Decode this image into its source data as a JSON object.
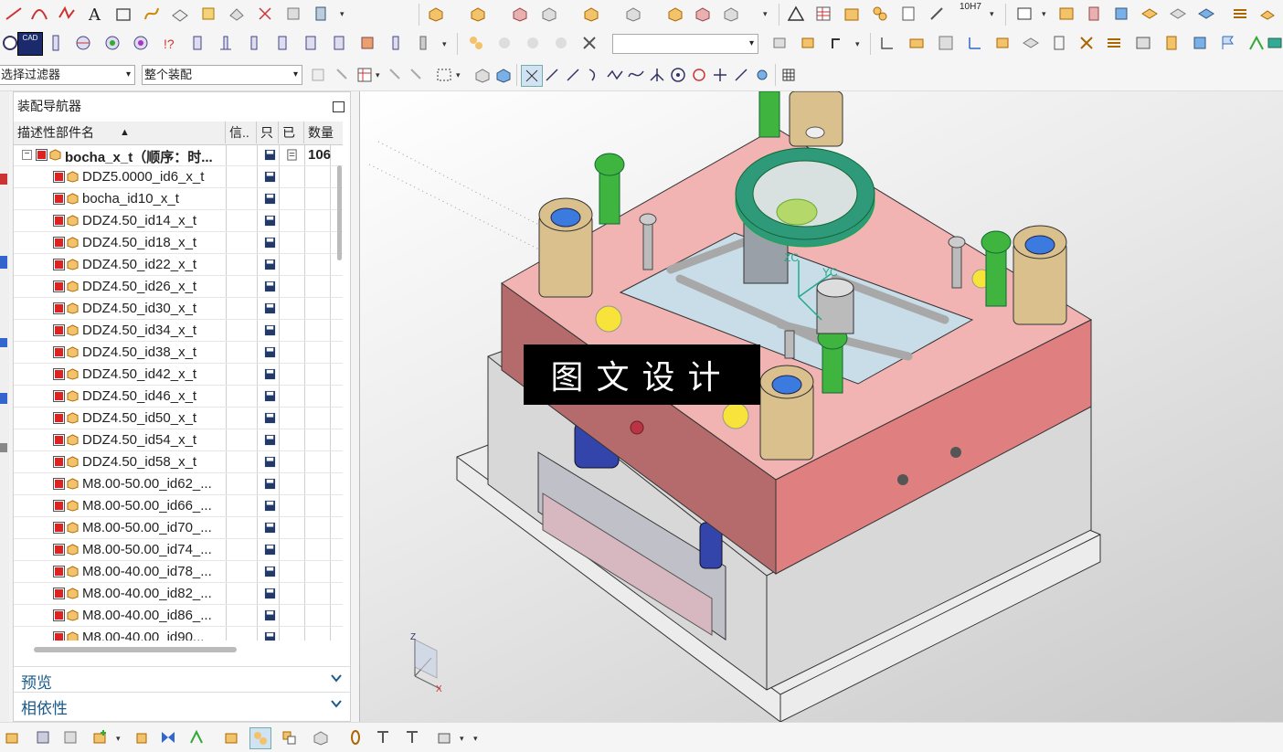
{
  "toolbar": {
    "row1_icons": [
      "line-icon",
      "arc-icon",
      "spline-icon",
      "text-icon",
      "sketch-icon",
      "curve-icon",
      "surface-icon",
      "extract-icon",
      "offset-icon",
      "project-icon",
      "intersect-icon",
      "section-icon",
      "boolean-icon",
      "extrude-icon",
      "revolve-icon",
      "hole-icon",
      "boss-icon",
      "pocket-icon",
      "pad-icon",
      "chamfer-icon",
      "shell-icon",
      "triangle-icon",
      "table-icon",
      "analysis-icon",
      "measure-icon",
      "document-icon",
      "drafting-icon",
      "tolerance-icon",
      "frame-icon",
      "mold-icon",
      "door-icon",
      "block-icon",
      "slab-icon",
      "layer-icon",
      "book-icon",
      "stack-icon",
      "chair-icon"
    ],
    "tolerance_label": "10H7",
    "row2_icons": [
      "view-icon",
      "cad-icon",
      "pin-icon",
      "cross-icon",
      "target-icon",
      "circle-target-icon",
      "exclaim-icon",
      "bracket-icon",
      "pillar-icon",
      "column-icon",
      "rail-icon",
      "slot-icon",
      "frame-icon",
      "grid-icon",
      "bar-icon",
      "divider-icon"
    ],
    "row2_right_icons": [
      "assembly-icon",
      "component-icon",
      "pattern-icon",
      "mirror-icon",
      "tools-icon",
      "cube-icon",
      "cube-yellow-icon",
      "music-note-icon",
      "hierarchy-icon",
      "plate-icon",
      "matrix-icon",
      "coordinate-icon",
      "box-icon",
      "section-view-icon",
      "bracket-view-icon",
      "wrench-icon",
      "stack-icon",
      "ladder-icon",
      "bars-icon",
      "profile-icon",
      "flag-icon",
      "crane-icon",
      "layer-icon"
    ],
    "cad_label": "CAD",
    "filter_select": "选择过滤器",
    "scope_select": "整个装配",
    "row3_icons": [
      "snap-icon",
      "select-icon",
      "move-icon",
      "copy-icon",
      "rect-select-icon",
      "solid-icon",
      "cube-blue-icon",
      "point-snap-icon",
      "line-snap-icon",
      "line2-snap-icon",
      "curve-snap-icon",
      "spline-snap-icon",
      "wave-snap-icon",
      "intersection-snap-icon",
      "center-snap-icon",
      "quadrant-snap-icon",
      "plus-snap-icon",
      "tangent-snap-icon",
      "existing-point-icon",
      "grid-icon"
    ]
  },
  "navigator": {
    "title": "装配导航器",
    "columns": {
      "name": "描述性部件名",
      "info": "信..",
      "c1": "只",
      "c2": "已",
      "qty": "数量"
    },
    "root": {
      "name": "bocha_x_t（顺序：时...",
      "qty": "106"
    },
    "items": [
      "DDZ5.0000_id6_x_t",
      "bocha_id10_x_t",
      "DDZ4.50_id14_x_t",
      "DDZ4.50_id18_x_t",
      "DDZ4.50_id22_x_t",
      "DDZ4.50_id26_x_t",
      "DDZ4.50_id30_x_t",
      "DDZ4.50_id34_x_t",
      "DDZ4.50_id38_x_t",
      "DDZ4.50_id42_x_t",
      "DDZ4.50_id46_x_t",
      "DDZ4.50_id50_x_t",
      "DDZ4.50_id54_x_t",
      "DDZ4.50_id58_x_t",
      "M8.00-50.00_id62_...",
      "M8.00-50.00_id66_...",
      "M8.00-50.00_id70_...",
      "M8.00-50.00_id74_...",
      "M8.00-40.00_id78_...",
      "M8.00-40.00_id82_...",
      "M8.00-40.00_id86_...",
      "M8.00-40.00_id90..."
    ],
    "sections": {
      "preview": "预览",
      "dependency": "相依性"
    }
  },
  "viewport": {
    "overlay_text": "图文设计",
    "axis_labels": {
      "zc": "ZC",
      "yc": "YC",
      "z": "Z",
      "x": "X"
    },
    "plate_color": "#f2b3b3",
    "base_color": "#e6e6e6",
    "ring_color": "#2e9a7a",
    "bolt_color": "#3fb53f",
    "bushing_color": "#d9c08c"
  },
  "bottombar": {
    "icons": [
      "component-icon",
      "assembly-icon",
      "add-component-icon",
      "move-icon",
      "mirror-icon",
      "constraint-icon",
      "explode-icon",
      "cut-icon",
      "pattern-icon",
      "section-icon",
      "link-icon",
      "reference-icon",
      "reference2-icon",
      "wave-icon"
    ]
  }
}
